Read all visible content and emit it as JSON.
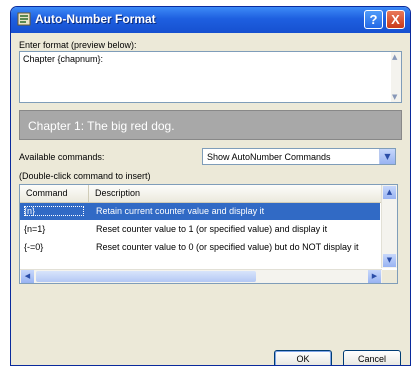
{
  "window": {
    "title": "Auto-Number Format",
    "help_label": "?",
    "close_label": "X"
  },
  "format": {
    "label": "Enter format (preview below):",
    "value": "Chapter {chapnum}:"
  },
  "preview": {
    "text": "Chapter 1: The big red dog."
  },
  "commands": {
    "label": "Available commands:",
    "dropdown_value": "Show AutoNumber Commands",
    "hint": "(Double-click command to insert)",
    "columns": [
      "Command",
      "Description"
    ],
    "rows": [
      {
        "command": "{n}",
        "description": "Retain current counter value and display it",
        "selected": true
      },
      {
        "command": "{n=1}",
        "description": "Reset counter value to 1 (or specified value) and display it",
        "selected": false
      },
      {
        "command": "{-=0}",
        "description": "Reset counter value to 0 (or specified value) but do NOT display it",
        "selected": false
      }
    ]
  },
  "buttons": {
    "ok": "OK",
    "cancel": "Cancel"
  },
  "colors": {
    "titlebar": "#1e5fe0",
    "selection": "#316ac5",
    "preview_bg": "#a8a8a8",
    "dialog_bg": "#ece9d8"
  }
}
